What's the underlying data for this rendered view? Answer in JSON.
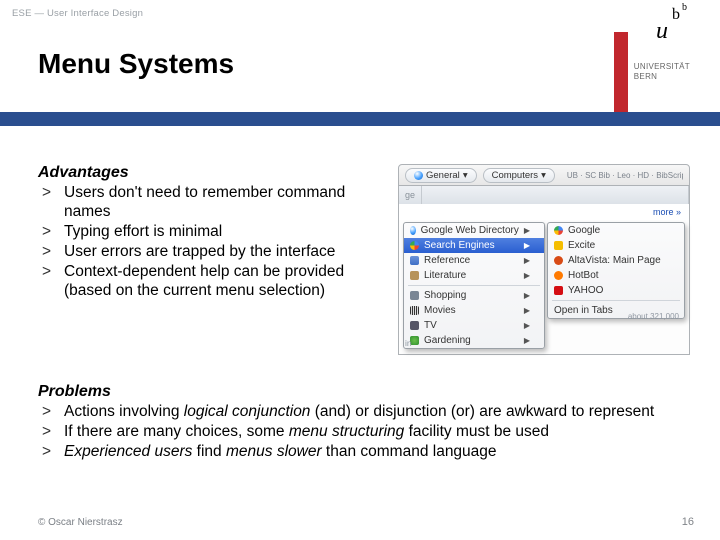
{
  "header": {
    "course": "ESE — User Interface Design"
  },
  "title": "Menu Systems",
  "university": {
    "line1": "UNIVERSITÄT",
    "line2": "BERN",
    "u": "u",
    "b": "b"
  },
  "advantages": {
    "heading": "Advantages",
    "items": [
      "Users don't need to remember command names",
      "Typing effort is minimal",
      "User errors are trapped by the interface",
      "Context-dependent help can be provided (based on the current menu selection)"
    ]
  },
  "problems": {
    "heading": "Problems",
    "p1_a": "Actions involving ",
    "p1_b": "logical conjunction",
    "p1_c": " (and) or disjunction (or) are awkward to represent",
    "p2_a": "If there are many choices, some ",
    "p2_b": "menu structuring",
    "p2_c": " facility must be used",
    "p3_a": "Experienced users",
    "p3_b": " find ",
    "p3_c": "menus slower",
    "p3_d": " than command language"
  },
  "mock": {
    "toolbar": {
      "btn1": "General",
      "btn2": "Computers",
      "tail": "UB · SC Bib · Leo · HD · BibScript"
    },
    "tabs": {
      "left_trunc": "ge",
      "center": "…",
      "more": "more »"
    },
    "under": {
      "link1": "",
      "link_right": "in"
    },
    "panelA": [
      {
        "label": "Google Web Directory",
        "icon": "d-globe",
        "caret": true,
        "sel": false
      },
      {
        "label": "Search Engines",
        "icon": "d-goog",
        "caret": true,
        "sel": true
      },
      {
        "label": "Reference",
        "icon": "d-ref",
        "caret": true,
        "sel": false
      },
      {
        "label": "Literature",
        "icon": "d-lit",
        "caret": true,
        "sel": false
      },
      {
        "sep": true
      },
      {
        "label": "Shopping",
        "icon": "d-cart",
        "caret": true,
        "sel": false
      },
      {
        "label": "Movies",
        "icon": "d-film",
        "caret": true,
        "sel": false
      },
      {
        "label": "TV",
        "icon": "d-tv",
        "caret": true,
        "sel": false
      },
      {
        "label": "Gardening",
        "icon": "d-leaf",
        "caret": true,
        "sel": false
      }
    ],
    "panelB_top": [
      {
        "label": "Google",
        "icon": "d-goog"
      },
      {
        "label": "Excite",
        "icon": "d-excite"
      },
      {
        "label": "AltaVista: Main Page",
        "icon": "d-av"
      },
      {
        "label": "HotBot",
        "icon": "d-hot"
      },
      {
        "label": "YAHOO",
        "icon": "d-y"
      }
    ],
    "panelB_bottom": {
      "label": "Open in Tabs"
    },
    "ghost_tr": "about 321,000",
    "ghost_bl": ""
  },
  "footer": {
    "left": "© Oscar Nierstrasz",
    "right": "16"
  }
}
